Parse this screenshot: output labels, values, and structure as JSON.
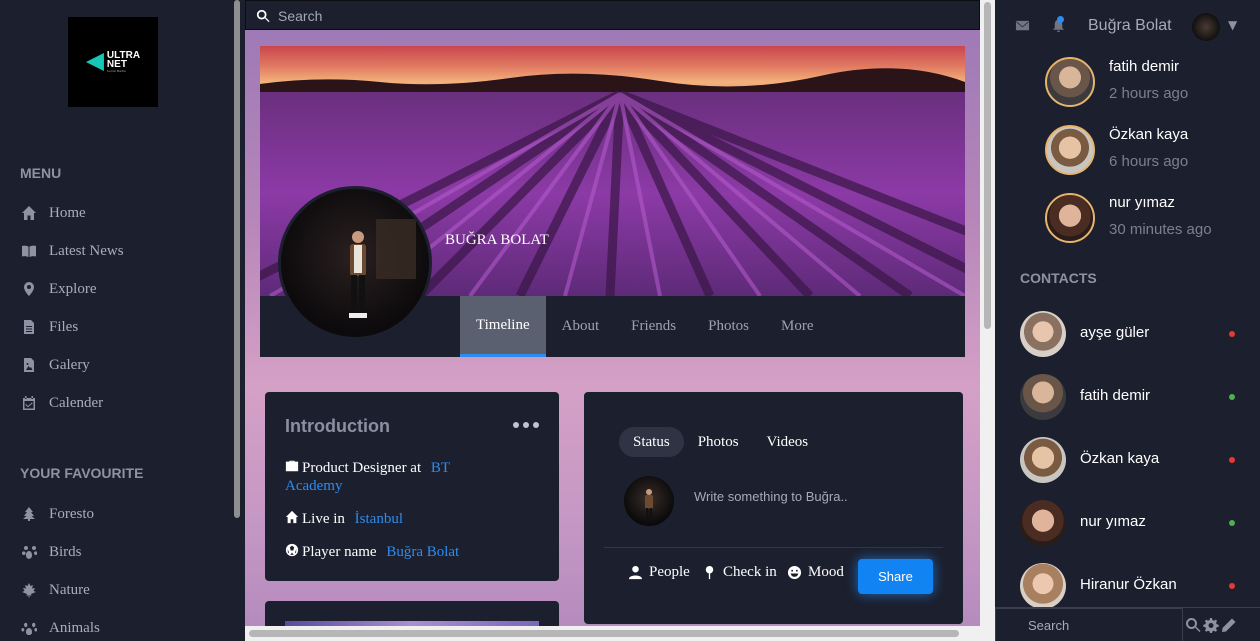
{
  "logo": {
    "line1": "ULTRA",
    "line2": "NET",
    "line3": "Social Media"
  },
  "sidebar": {
    "menu_heading": "MENU",
    "menu": [
      {
        "label": "Home",
        "icon": "home-icon"
      },
      {
        "label": "Latest News",
        "icon": "book-icon"
      },
      {
        "label": "Explore",
        "icon": "map-pin-icon"
      },
      {
        "label": "Files",
        "icon": "file-icon"
      },
      {
        "label": "Galery",
        "icon": "image-file-icon"
      },
      {
        "label": "Calender",
        "icon": "calendar-icon"
      }
    ],
    "fav_heading": "YOUR FAVOURITE",
    "favourites": [
      {
        "label": "Foresto",
        "icon": "tree-icon"
      },
      {
        "label": "Birds",
        "icon": "bird-icon"
      },
      {
        "label": "Nature",
        "icon": "leaf-icon"
      },
      {
        "label": "Animals",
        "icon": "paw-icon"
      }
    ]
  },
  "search": {
    "placeholder": "Search"
  },
  "profile": {
    "name": "BUĞRA BOLAT",
    "tabs": [
      "Timeline",
      "About",
      "Friends",
      "Photos",
      "More"
    ],
    "active_tab": "Timeline"
  },
  "intro": {
    "title": "Introduction",
    "job_prefix": "Product Designer at",
    "job_link": "BT Academy",
    "live_prefix": "Live in",
    "live_link": "İstanbul",
    "player_prefix": "Player name",
    "player_link": "Buğra Bolat"
  },
  "post": {
    "tabs": [
      "Status",
      "Photos",
      "Videos"
    ],
    "active_tab": "Status",
    "placeholder": "Write something to Buğra..",
    "actions": [
      "People",
      "Check in",
      "Mood"
    ],
    "share_label": "Share"
  },
  "header": {
    "user_name": "Buğra Bolat"
  },
  "notifications": [
    {
      "name": "fatih demir",
      "time": "2 hours ago"
    },
    {
      "name": "Özkan kaya",
      "time": "6 hours ago"
    },
    {
      "name": "nur yımaz",
      "time": "30 minutes ago"
    }
  ],
  "contacts_heading": "CONTACTS",
  "contacts": [
    {
      "name": "ayşe güler",
      "status": "offline"
    },
    {
      "name": "fatih demir",
      "status": "online"
    },
    {
      "name": "Özkan kaya",
      "status": "offline"
    },
    {
      "name": "nur yımaz",
      "status": "online"
    },
    {
      "name": "Hiranur Özkan",
      "status": "offline"
    }
  ],
  "bottom_search": {
    "placeholder": "Search"
  },
  "colors": {
    "accent": "#2d8cf0",
    "online": "#4caf50",
    "offline": "#e53935",
    "panel": "#1c1f2d",
    "ring": "#e6b46b"
  }
}
